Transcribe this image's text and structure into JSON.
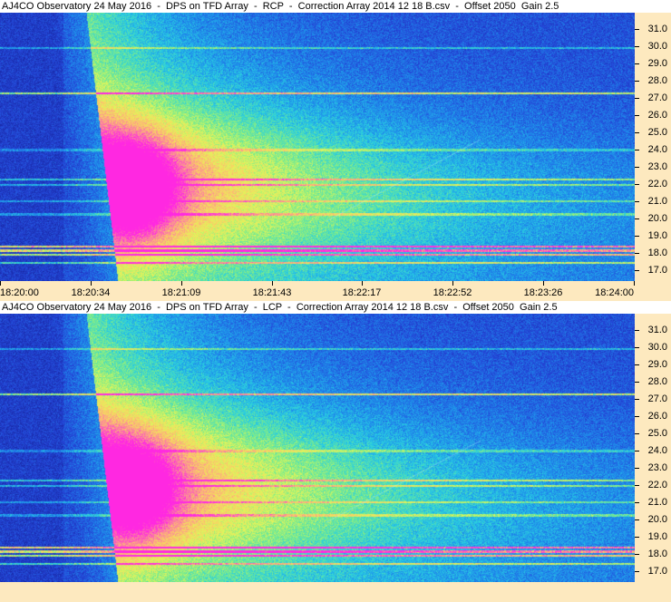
{
  "panels": [
    {
      "title": "AJ4CO Observatory 24 May 2016  -  DPS on TFD Array  -  RCP  -  Correction Array 2014 12 18 B.csv  -  Offset 2050  Gain 2.5",
      "polarization": "RCP",
      "time_labels": [
        "18:20:00",
        "18:20:34",
        "18:21:09",
        "18:21:43",
        "18:22:17",
        "18:22:52",
        "18:23:26",
        "18:24:00"
      ],
      "freq_labels": [
        "31.0",
        "30.0",
        "29.0",
        "28.0",
        "27.0",
        "26.0",
        "25.0",
        "24.0",
        "23.0",
        "22.0",
        "21.0",
        "20.0",
        "19.0",
        "18.0",
        "17.0"
      ]
    },
    {
      "title": "AJ4CO Observatory 24 May 2016  -  DPS on TFD Array  -  LCP  -  Correction Array 2014 12 18 B.csv  -  Offset 2050  Gain 2.5",
      "polarization": "LCP",
      "freq_labels": [
        "31.0",
        "30.0",
        "29.0",
        "28.0",
        "27.0",
        "26.0",
        "25.0",
        "24.0",
        "23.0",
        "22.0",
        "21.0",
        "20.0",
        "19.0",
        "18.0",
        "17.0"
      ]
    }
  ],
  "colors": {
    "axis_background": "#fde9bf",
    "spectrum_low": "#1f33c8",
    "spectrum_high": "#ff30e0"
  }
}
